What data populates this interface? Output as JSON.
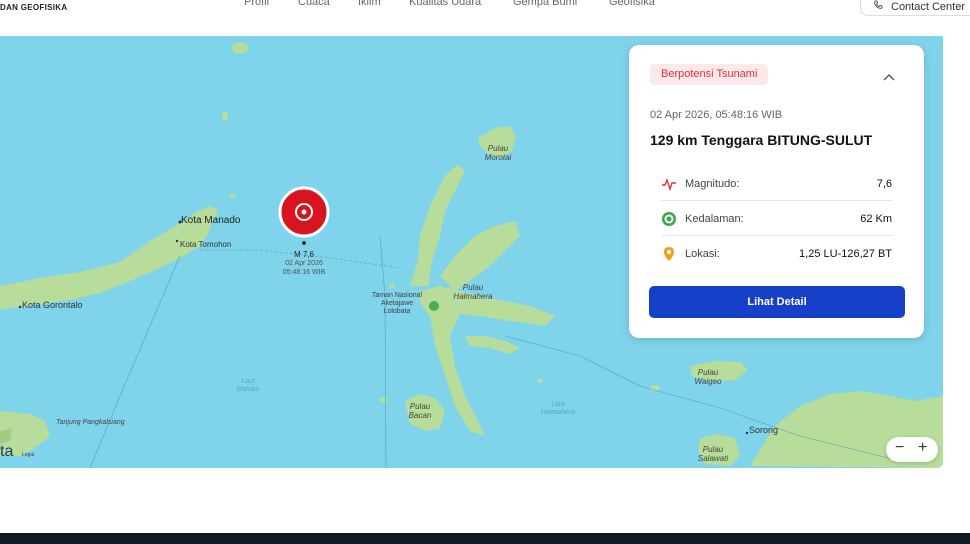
{
  "header": {
    "brand": "DAN GEOFISIKA",
    "nav": [
      "Profil",
      "Cuaca",
      "Iklim",
      "Kualitas Udara",
      "Gempa Bumi",
      "Geofisika"
    ],
    "contact_label": "Contact Center"
  },
  "map": {
    "places": {
      "manado": "Kota Manado",
      "tomohon": "Kota Tomohon",
      "gorontalo": "Kota Gorontalo",
      "morotai": "Pulau\nMorotai",
      "halmahera": "Pulau\nHalmahera",
      "taman": "Taman Nasional\nAketajawe\nLolobata",
      "laut_maluku": "Laut\nMaluku",
      "bacan": "Pulau\nBacan",
      "laut_halmahera": "Laut\nHalmahera",
      "waigeo": "Pulau\nWaigeo",
      "sorong": "Sorong",
      "salawati": "Pulau\nSalawati",
      "pangkalsiang": "Tanjung Pangkalsiang",
      "ta": "ta",
      "legal": "Legal"
    },
    "epicenter": {
      "magnitude_label": "M 7,6",
      "date": "02 Apr 2026",
      "time": "05:48:16 WIB"
    },
    "zoom_out": "−",
    "zoom_in": "+"
  },
  "card": {
    "badge": "Berpotensi Tsunami",
    "datetime": "02 Apr 2026, 05:48:16 WIB",
    "place": "129 km Tenggara BITUNG-SULUT",
    "rows": [
      {
        "key": "Magnitudo:",
        "value": "7,6",
        "icon": "pulse-icon"
      },
      {
        "key": "Kedalaman:",
        "value": "62 Km",
        "icon": "target-icon"
      },
      {
        "key": "Lokasi:",
        "value": "1,25 LU-126,27 BT",
        "icon": "location-pin-icon"
      }
    ],
    "detail_button": "Lihat Detail"
  },
  "colors": {
    "sea": "#7fd3ea",
    "land": "#b8dd9a",
    "accent": "#1640c8",
    "alert": "#d8323c"
  }
}
